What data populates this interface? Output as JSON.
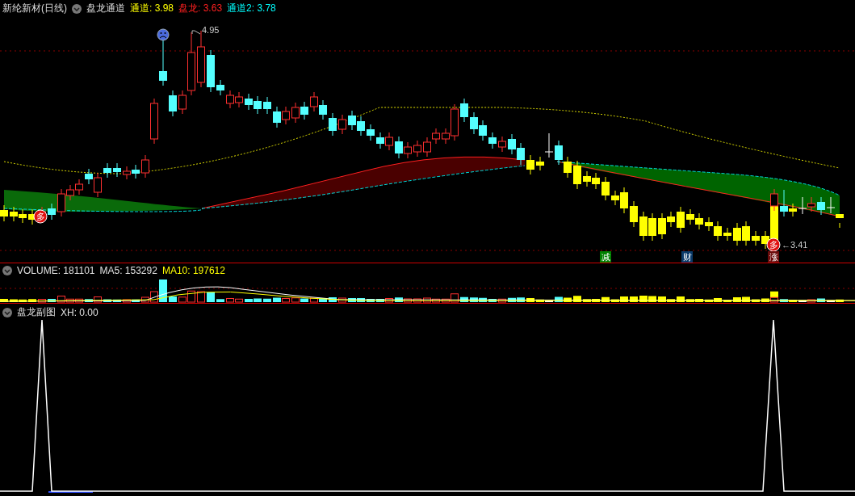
{
  "main_panel": {
    "title": "新纶新材(日线)",
    "indicator": "盘龙通道",
    "readings": [
      {
        "text": "通道: 3.98",
        "color": "#ffff00"
      },
      {
        "text": "盘龙: 3.63",
        "color": "#ff2020"
      },
      {
        "text": "通道2: 3.78",
        "color": "#00ffff"
      }
    ],
    "price_labels": [
      {
        "kind": "high",
        "text": "4.95"
      },
      {
        "kind": "low",
        "text": "←3.41"
      }
    ],
    "signals": [
      {
        "kind": "circle",
        "text": "多",
        "color": "#e01010"
      },
      {
        "kind": "circle",
        "text": "多",
        "color": "#e01010"
      },
      {
        "kind": "box",
        "text": "减",
        "color": "#008000"
      },
      {
        "kind": "box",
        "text": "财",
        "color": "#0a3a6a"
      },
      {
        "kind": "box",
        "text": "涨",
        "color": "#6a0a0a"
      }
    ]
  },
  "volume_panel": {
    "readings": [
      {
        "text": "VOLUME: 181101",
        "color": "#e0e0e0"
      },
      {
        "text": "MA5: 153292",
        "color": "#e0e0e0"
      },
      {
        "text": "MA10: 197612",
        "color": "#ffff00"
      }
    ]
  },
  "sub_panel": {
    "title": "盘龙副图",
    "readings": [
      {
        "text": "XH: 0.00",
        "color": "#e0e0e0"
      }
    ]
  }
}
